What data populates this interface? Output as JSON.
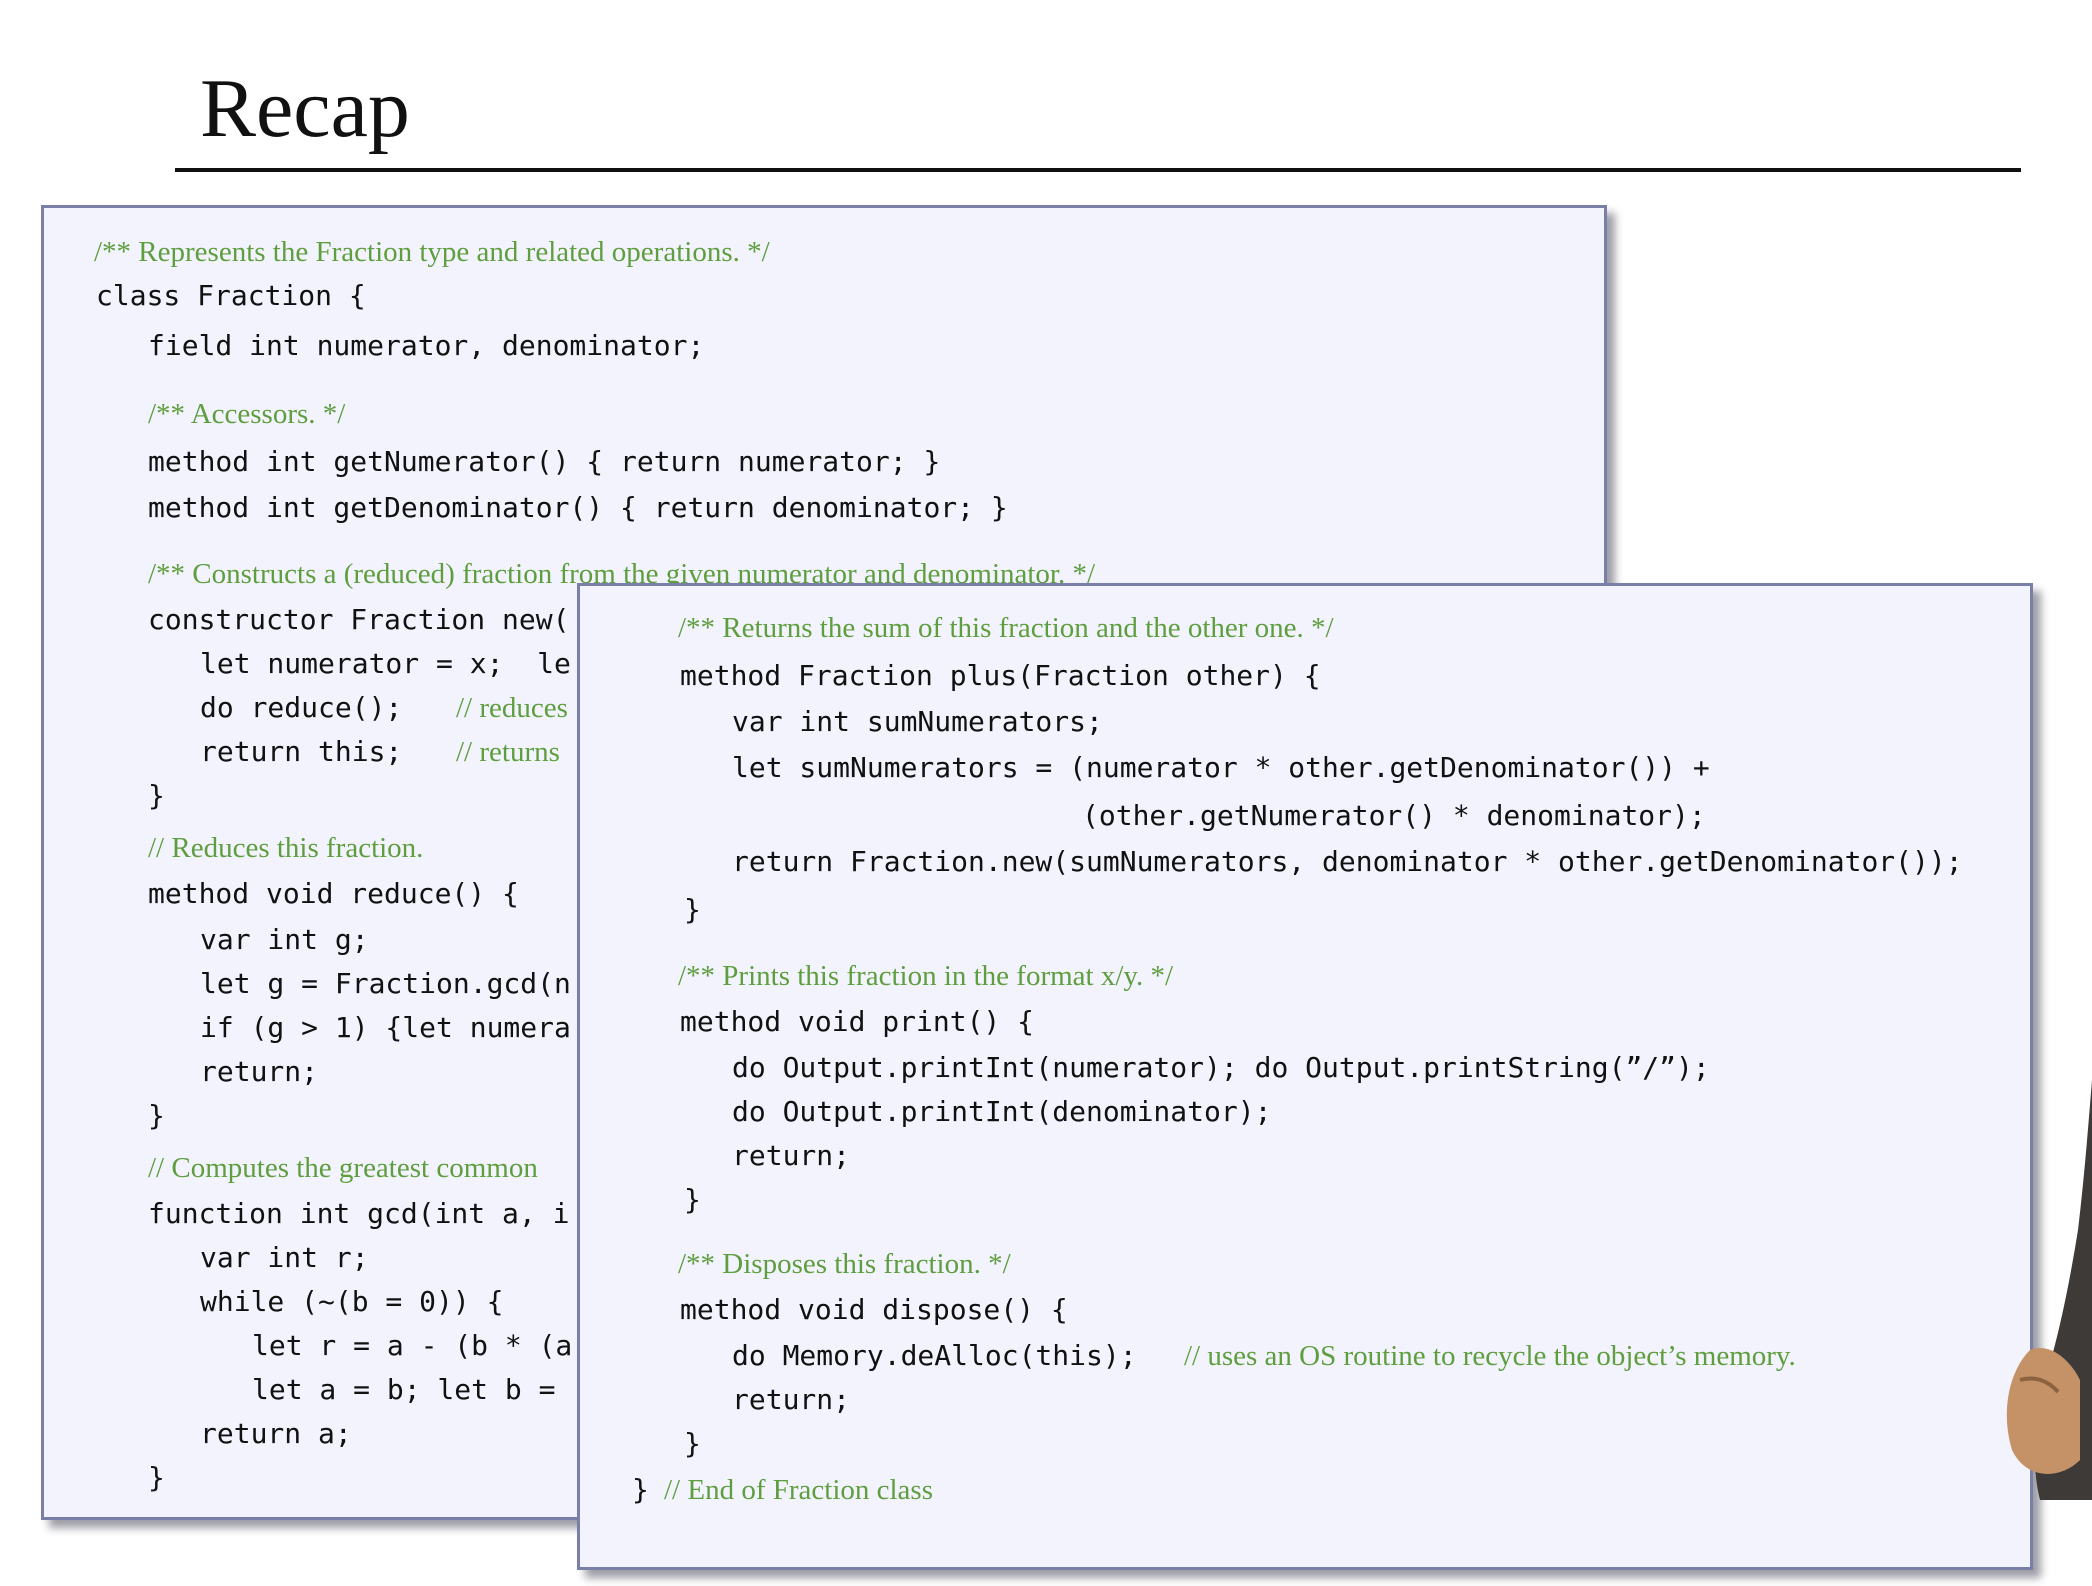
{
  "slide": {
    "title": "Recap"
  },
  "back_panel": {
    "lines": [
      {
        "kind": "cmt",
        "text": "/** Represents the Fraction type and related operations. */"
      },
      {
        "kind": "code",
        "text": "class Fraction {"
      },
      {
        "kind": "code",
        "text": "field int numerator, denominator;"
      },
      {
        "kind": "cmt",
        "text": "/** Accessors. */"
      },
      {
        "kind": "code",
        "text": "method int getNumerator() { return numerator; }"
      },
      {
        "kind": "code",
        "text": "method int getDenominator() { return denominator; }"
      },
      {
        "kind": "cmt",
        "text": "/** Constructs a (reduced) fraction from the given numerator and denominator. */"
      },
      {
        "kind": "code",
        "text": "constructor Fraction new("
      },
      {
        "kind": "code",
        "text": "let numerator = x;  le"
      },
      {
        "kind": "code",
        "text": "do reduce();"
      },
      {
        "kind": "cmt",
        "text": "// reduces"
      },
      {
        "kind": "code",
        "text": "return this;"
      },
      {
        "kind": "cmt",
        "text": "// returns"
      },
      {
        "kind": "code",
        "text": "}"
      },
      {
        "kind": "cmt",
        "text": "// Reduces this fraction."
      },
      {
        "kind": "code",
        "text": "method void reduce() {"
      },
      {
        "kind": "code",
        "text": "var int g;"
      },
      {
        "kind": "code",
        "text": "let g = Fraction.gcd(n"
      },
      {
        "kind": "code",
        "text": "if (g > 1) {let numera"
      },
      {
        "kind": "code",
        "text": "return;"
      },
      {
        "kind": "code",
        "text": "}"
      },
      {
        "kind": "cmt",
        "text": "// Computes the greatest common"
      },
      {
        "kind": "code",
        "text": "function int gcd(int a, i"
      },
      {
        "kind": "code",
        "text": "var int r;"
      },
      {
        "kind": "code",
        "text": "while (~(b = 0)) {"
      },
      {
        "kind": "code",
        "text": "let r = a - (b * (a"
      },
      {
        "kind": "code",
        "text": "let a = b; let b ="
      },
      {
        "kind": "code",
        "text": "return a;"
      },
      {
        "kind": "code",
        "text": "}"
      }
    ]
  },
  "front_panel": {
    "lines": [
      {
        "kind": "cmt",
        "text": "/** Returns the sum of this fraction and the other one. */"
      },
      {
        "kind": "code",
        "text": "method Fraction plus(Fraction other) {"
      },
      {
        "kind": "code",
        "text": "var int sumNumerators;"
      },
      {
        "kind": "code",
        "text": "let sumNumerators = (numerator * other.getDenominator()) +"
      },
      {
        "kind": "code",
        "text": "(other.getNumerator() * denominator);"
      },
      {
        "kind": "code",
        "text": "return Fraction.new(sumNumerators, denominator * other.getDenominator());"
      },
      {
        "kind": "code",
        "text": "}"
      },
      {
        "kind": "cmt",
        "text": "/** Prints this fraction in the format x/y. */"
      },
      {
        "kind": "code",
        "text": "method void print() {"
      },
      {
        "kind": "code",
        "text": "do Output.printInt(numerator); do Output.printString(”/”);"
      },
      {
        "kind": "code",
        "text": "do Output.printInt(denominator);"
      },
      {
        "kind": "code",
        "text": "return;"
      },
      {
        "kind": "code",
        "text": "}"
      },
      {
        "kind": "cmt",
        "text": "/** Disposes this fraction. */"
      },
      {
        "kind": "code",
        "text": "method void dispose() {"
      },
      {
        "kind": "code",
        "text": "do Memory.deAlloc(this);"
      },
      {
        "kind": "cmt",
        "text": "// uses an OS routine to recycle the object’s memory."
      },
      {
        "kind": "code",
        "text": "return;"
      },
      {
        "kind": "code",
        "text": "}"
      },
      {
        "kind": "code",
        "text": "}"
      },
      {
        "kind": "cmt",
        "text": "// End of Fraction class"
      }
    ]
  }
}
